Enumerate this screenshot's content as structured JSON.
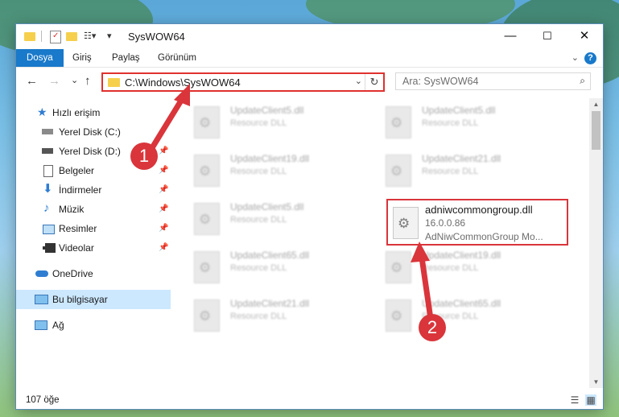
{
  "window": {
    "title": "SysWOW64"
  },
  "controls": {
    "minimize": "—",
    "maximize": "☐",
    "close": "✕"
  },
  "ribbon": {
    "tabs": [
      "Dosya",
      "Giriş",
      "Paylaş",
      "Görünüm"
    ],
    "help": "?"
  },
  "nav": {
    "back": "←",
    "forward": "→",
    "recent": "⌄",
    "up": "↑"
  },
  "address": {
    "path": "C:\\Windows\\SysWOW64",
    "dropdown": "⌄",
    "refresh": "↻"
  },
  "search": {
    "placeholder": "Ara: SysWOW64",
    "icon": "⌕"
  },
  "sidebar": {
    "items": [
      {
        "label": "Hızlı erişim",
        "icon": "star-icon"
      },
      {
        "label": "Yerel Disk (C:)",
        "icon": "drive-icon"
      },
      {
        "label": "Yerel Disk (D:)",
        "icon": "drive-icon"
      },
      {
        "label": "Belgeler",
        "icon": "document-icon"
      },
      {
        "label": "İndirmeler",
        "icon": "download-icon"
      },
      {
        "label": "Müzik",
        "icon": "music-icon"
      },
      {
        "label": "Resimler",
        "icon": "pictures-icon"
      },
      {
        "label": "Videolar",
        "icon": "video-icon"
      },
      {
        "label": "OneDrive",
        "icon": "cloud-icon"
      },
      {
        "label": "Bu bilgisayar",
        "icon": "computer-icon"
      },
      {
        "label": "Ağ",
        "icon": "network-icon"
      }
    ]
  },
  "files": [
    {
      "name": "UpdateClient5.dll",
      "desc": "Resource DLL"
    },
    {
      "name": "UpdateClient5.dll",
      "desc": "Resource DLL"
    },
    {
      "name": "UpdateClient19.dll",
      "desc": "Resource DLL"
    },
    {
      "name": "UpdateClient21.dll",
      "desc": "Resource DLL"
    },
    {
      "name": "UpdateClient5.dll",
      "desc": "Resource DLL"
    },
    {
      "name": "adniwcommongroup.dll",
      "desc": "16.0.0.86",
      "desc2": "AdNiwCommonGroup Mo..."
    },
    {
      "name": "UpdateClient65.dll",
      "desc": "Resource DLL"
    },
    {
      "name": "UpdateClient19.dll",
      "desc": "Resource DLL"
    },
    {
      "name": "UpdateClient21.dll",
      "desc": "Resource DLL"
    },
    {
      "name": "UpdateClient65.dll",
      "desc": "Resource DLL"
    }
  ],
  "status": {
    "count": "107 öğe"
  },
  "markers": [
    "1",
    "2"
  ],
  "colors": {
    "accent": "#1979ca",
    "highlight": "#d9353b",
    "selected": "#cce8ff"
  }
}
